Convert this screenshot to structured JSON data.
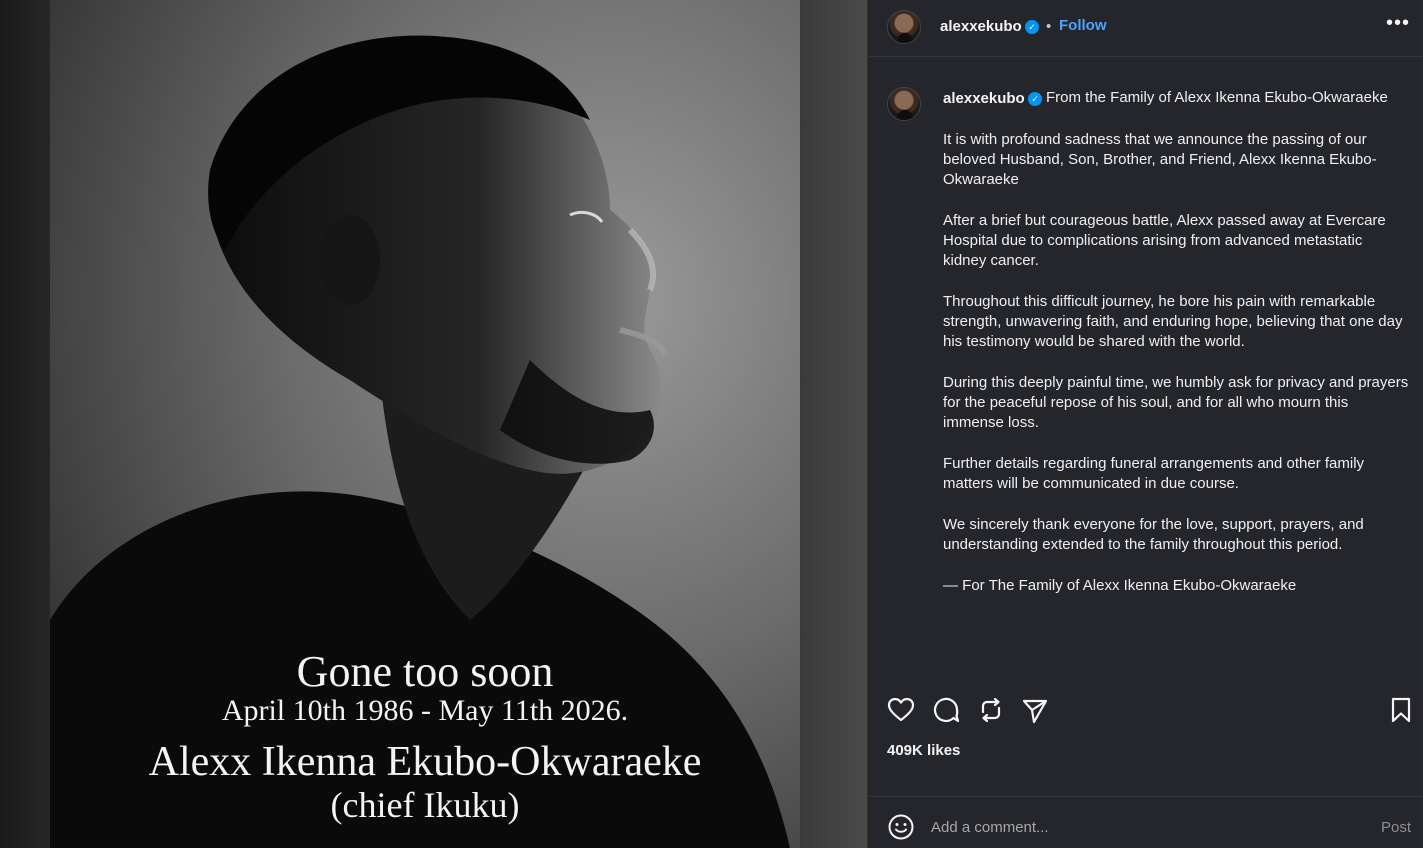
{
  "post": {
    "headline": "Gone too soon",
    "dates": "April 10th 1986 - May 11th 2026.",
    "name": "Alexx Ikenna Ekubo-Okwaraeke",
    "nickname": "(chief Ikuku)"
  },
  "header": {
    "username": "alexxekubo",
    "separator": "•",
    "follow_label": "Follow",
    "more_label": "•••"
  },
  "caption": {
    "username": "alexxekubo",
    "first_line": "From the Family of Alexx Ikenna Ekubo-Okwaraeke",
    "paragraphs": [
      "It is with profound sadness that we announce the passing of our beloved Husband, Son, Brother, and Friend, Alexx Ikenna Ekubo-Okwaraeke",
      "After a brief but courageous battle, Alexx passed away at Evercare Hospital due to complications arising from advanced metastatic kidney cancer.",
      "Throughout this difficult journey, he bore his pain with remarkable strength, unwavering faith, and enduring hope, believing that one day his testimony would be shared with the world.",
      "During this deeply painful time, we humbly ask for privacy and prayers for the peaceful repose of his soul, and for all who mourn this immense loss.",
      "Further details regarding funeral arrangements and other family matters will be communicated in due course.",
      "We sincerely thank everyone for the love, support, prayers, and understanding extended to the family throughout this period.",
      "— For The Family of Alexx Ikenna Ekubo-Okwaraeke"
    ]
  },
  "stats": {
    "likes": "409K likes"
  },
  "comment": {
    "placeholder": "Add a comment...",
    "post_label": "Post"
  },
  "icons": {
    "like": "heart-icon",
    "comment": "comment-icon",
    "repost": "repost-icon",
    "share": "share-icon",
    "save": "bookmark-icon",
    "emoji": "emoji-icon",
    "verified": "verified-badge-icon"
  },
  "colors": {
    "panel_bg": "#25262c",
    "link_blue": "#4aa3ff",
    "verified_blue": "#0095f6"
  }
}
